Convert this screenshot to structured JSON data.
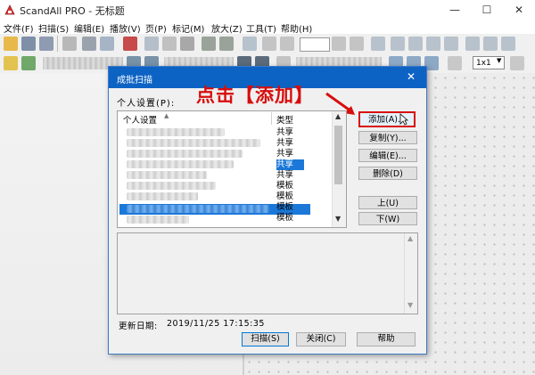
{
  "app": {
    "title": "ScandAll PRO - 无标题",
    "minimize": "—",
    "maximize": "☐",
    "close": "✕"
  },
  "menu": [
    {
      "label": "文件(F)"
    },
    {
      "label": "扫描(S)"
    },
    {
      "label": "编辑(E)"
    },
    {
      "label": "播放(V)"
    },
    {
      "label": "页(P)"
    },
    {
      "label": "标记(M)"
    },
    {
      "label": "放大(Z)"
    },
    {
      "label": "工具(T)"
    },
    {
      "label": "帮助(H)"
    }
  ],
  "toolbar": {
    "zoom_value": "1x1"
  },
  "dialog": {
    "title": "成批扫描",
    "close": "✕",
    "profile_label": "个人设置(P):",
    "annotation": "点击【添加】",
    "list": {
      "col_name": "个人设置",
      "col_type": "类型",
      "rows": [
        {
          "type": "共享"
        },
        {
          "type": "共享"
        },
        {
          "type": "共享"
        },
        {
          "type": "共享"
        },
        {
          "type": "共享"
        },
        {
          "type": "模板"
        },
        {
          "type": "模板"
        },
        {
          "type": "模板"
        },
        {
          "type": "模板"
        }
      ]
    },
    "buttons": {
      "add": "添加(A)...",
      "copy": "复制(Y)...",
      "edit": "编辑(E)...",
      "delete": "删除(D)",
      "up": "上(U)",
      "down": "下(W)",
      "scan": "扫描(S)",
      "close": "关闭(C)",
      "help": "帮助"
    },
    "update_label": "更新日期:",
    "update_value": "2019/11/25 17:15:35"
  },
  "colors": {
    "dialog_title_bg": "#0d63c4",
    "selection": "#1b78d8",
    "annotation_red": "#d80d0d"
  }
}
